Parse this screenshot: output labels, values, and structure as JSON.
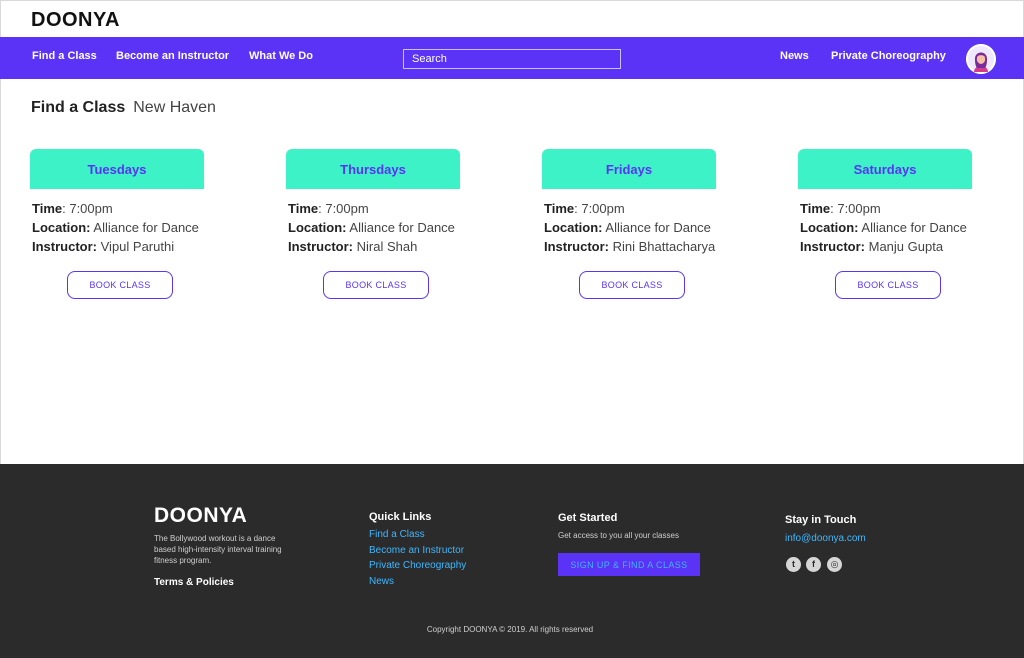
{
  "brand": {
    "logo": "DOONYA"
  },
  "nav": {
    "left": [
      "Find a Class",
      "Become an Instructor",
      "What We Do"
    ],
    "search_placeholder": "Search",
    "right": [
      "News",
      "Private Choreography"
    ]
  },
  "heading": {
    "title": "Find a Class",
    "city": "New Haven"
  },
  "labels": {
    "time": "Time",
    "location": "Location:",
    "instructor": "Instructor:"
  },
  "classes": [
    {
      "day": "Tuesdays",
      "time": ": 7:00pm",
      "location": "Alliance for Dance",
      "instructor": "Vipul Paruthi",
      "button": "BOOK CLASS"
    },
    {
      "day": "Thursdays",
      "time": ": 7:00pm",
      "location": "Alliance for Dance",
      "instructor": "Niral Shah",
      "button": "BOOK CLASS"
    },
    {
      "day": "Fridays",
      "time": ": 7:00pm",
      "location": "Alliance for Dance",
      "instructor": "Rini Bhattacharya",
      "button": "BOOK CLASS"
    },
    {
      "day": "Saturdays",
      "time": ": 7:00pm",
      "location": "Alliance for Dance",
      "instructor": "Manju Gupta",
      "button": "BOOK CLASS"
    }
  ],
  "footer": {
    "logo": "DOONYA",
    "tagline": "The Bollywood workout is a dance based high-intensity interval training fitness program.",
    "terms": "Terms & Policies",
    "quick_links_title": "Quick Links",
    "quick_links": [
      "Find a Class",
      "Become an Instructor",
      "Private Choreography",
      "News"
    ],
    "get_started_title": "Get Started",
    "get_started_sub": "Get access to you all  your classes",
    "signup_button": "SIGN UP & FIND A CLASS",
    "stay_title": "Stay in Touch",
    "email": "info@doonya.com",
    "social": [
      {
        "icon": "twitter-icon",
        "glyph": "t"
      },
      {
        "icon": "facebook-icon",
        "glyph": "f"
      },
      {
        "icon": "instagram-icon",
        "glyph": "◎"
      }
    ],
    "copyright": "Copyright DOONYA © 2019. All rights reserved"
  },
  "colors": {
    "brand_purple": "#5a33f6",
    "mint": "#3df2c7",
    "link_blue": "#3db7ff",
    "footer_bg": "#2b2b2b"
  }
}
